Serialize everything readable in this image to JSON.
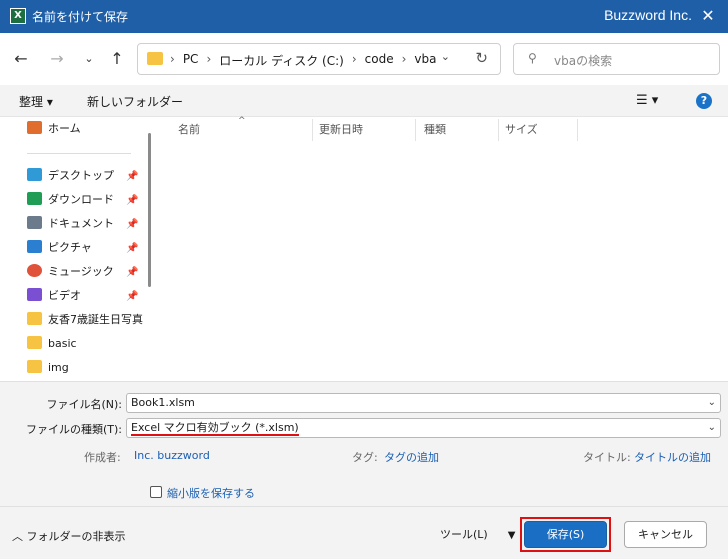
{
  "window": {
    "title": "名前を付けて保存",
    "brand": "Buzzword Inc.",
    "app_icon": "X"
  },
  "address": {
    "crumbs": [
      "PC",
      "ローカル ディスク (C:)",
      "code",
      "vba"
    ]
  },
  "search": {
    "placeholder": "vbaの検索"
  },
  "toolbar": {
    "organize": "整理 ▾",
    "new_folder": "新しいフォルダー",
    "view": "☰ ▾",
    "help": "?"
  },
  "sidebar": {
    "items": [
      {
        "label": "ホーム",
        "icon": "home-icon",
        "color": "#e06c2d"
      },
      {
        "label": "デスクトップ",
        "icon": "desktop-icon",
        "color": "#2f9ad6",
        "pinned": true
      },
      {
        "label": "ダウンロード",
        "icon": "download-icon",
        "color": "#1f9d55",
        "pinned": true
      },
      {
        "label": "ドキュメント",
        "icon": "document-icon",
        "color": "#6b7b8c",
        "pinned": true
      },
      {
        "label": "ピクチャ",
        "icon": "picture-icon",
        "color": "#2b7fd0",
        "pinned": true
      },
      {
        "label": "ミュージック",
        "icon": "music-icon",
        "color": "#e0523a",
        "pinned": true
      },
      {
        "label": "ビデオ",
        "icon": "video-icon",
        "color": "#7b4fd1",
        "pinned": true
      },
      {
        "label": "友香7歳誕生日写真",
        "icon": "folder-icon",
        "color": "#f6c343"
      },
      {
        "label": "basic",
        "icon": "folder-icon",
        "color": "#f6c343"
      },
      {
        "label": "img",
        "icon": "folder-icon",
        "color": "#f6c343"
      }
    ]
  },
  "columns": [
    "名前",
    "更新日時",
    "種類",
    "サイズ"
  ],
  "form": {
    "filename_label": "ファイル名(N):",
    "filename_value": "Book1.xlsm",
    "filetype_label": "ファイルの種類(T):",
    "filetype_value": "Excel マクロ有効ブック (*.xlsm)",
    "author_label": "作成者:",
    "author_value": "Inc. buzzword",
    "tags_label": "タグ:",
    "tags_value": "タグの追加",
    "title_label": "タイトル:",
    "title_value": "タイトルの追加",
    "thumbnail_label": "縮小版を保存する"
  },
  "bottom": {
    "hide_folders": "フォルダーの非表示",
    "tools": "ツール(L)",
    "save": "保存(S)",
    "cancel": "キャンセル"
  }
}
